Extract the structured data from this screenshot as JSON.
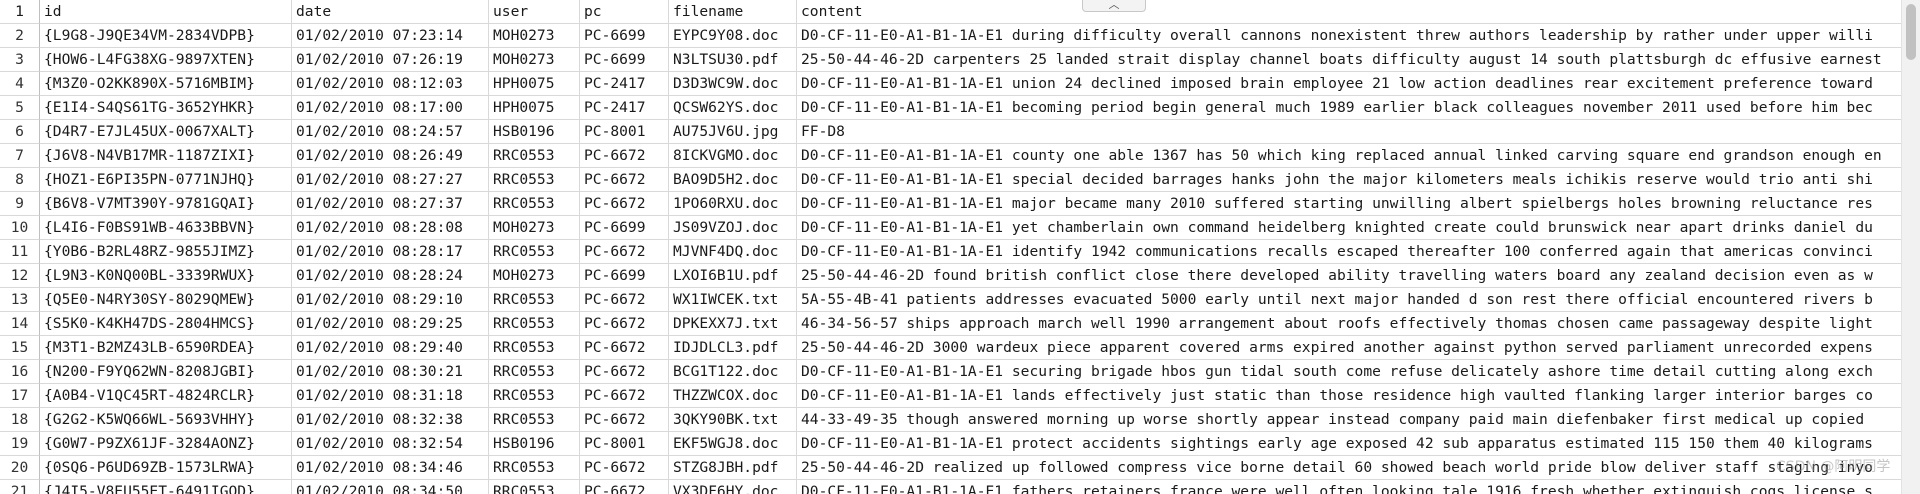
{
  "headers": {
    "row_num": "1",
    "id": "id",
    "date": "date",
    "user": "user",
    "pc": "pc",
    "filename": "filename",
    "content": "content"
  },
  "collapse_glyph": "︿",
  "watermark": "CSDN @阿明同学",
  "rows": [
    {
      "num": "2",
      "id": "{L9G8-J9QE34VM-2834VDPB}",
      "date": "01/02/2010 07:23:14",
      "user": "MOH0273",
      "pc": "PC-6699",
      "filename": "EYPC9Y08.doc",
      "content": "D0-CF-11-E0-A1-B1-1A-E1 during difficulty overall cannons nonexistent threw authors leadership by rather under upper willi"
    },
    {
      "num": "3",
      "id": "{HOW6-L4FG38XG-9897XTEN}",
      "date": "01/02/2010 07:26:19",
      "user": "MOH0273",
      "pc": "PC-6699",
      "filename": "N3LTSU30.pdf",
      "content": "25-50-44-46-2D carpenters 25 landed strait display channel boats difficulty august 14 south plattsburgh dc effusive earnest"
    },
    {
      "num": "4",
      "id": "{M3Z0-O2KK890X-5716MBIM}",
      "date": "01/02/2010 08:12:03",
      "user": "HPH0075",
      "pc": "PC-2417",
      "filename": "D3D3WC9W.doc",
      "content": "D0-CF-11-E0-A1-B1-1A-E1 union 24 declined imposed brain employee 21 low action deadlines rear excitement preference toward"
    },
    {
      "num": "5",
      "id": "{E1I4-S4QS61TG-3652YHKR}",
      "date": "01/02/2010 08:17:00",
      "user": "HPH0075",
      "pc": "PC-2417",
      "filename": "QCSW62YS.doc",
      "content": "D0-CF-11-E0-A1-B1-1A-E1 becoming period begin general much 1989 earlier black colleagues november 2011 used before him bec"
    },
    {
      "num": "6",
      "id": "{D4R7-E7JL45UX-0067XALT}",
      "date": "01/02/2010 08:24:57",
      "user": "HSB0196",
      "pc": "PC-8001",
      "filename": "AU75JV6U.jpg",
      "content": "FF-D8"
    },
    {
      "num": "7",
      "id": "{J6V8-N4VB17MR-1187ZIXI}",
      "date": "01/02/2010 08:26:49",
      "user": "RRC0553",
      "pc": "PC-6672",
      "filename": "8ICKVGMO.doc",
      "content": "D0-CF-11-E0-A1-B1-1A-E1 county one able 1367 has 50 which king replaced annual linked carving square end grandson enough en"
    },
    {
      "num": "8",
      "id": "{HOZ1-E6PI35PN-0771NJHQ}",
      "date": "01/02/2010 08:27:27",
      "user": "RRC0553",
      "pc": "PC-6672",
      "filename": "BAO9D5H2.doc",
      "content": "D0-CF-11-E0-A1-B1-1A-E1 special decided barrages hanks john the major kilometers meals ichikis reserve would trio anti shi"
    },
    {
      "num": "9",
      "id": "{B6V8-V7MT390Y-9781GQAI}",
      "date": "01/02/2010 08:27:37",
      "user": "RRC0553",
      "pc": "PC-6672",
      "filename": "1PO60RXU.doc",
      "content": "D0-CF-11-E0-A1-B1-1A-E1 major became many 2010 suffered starting unwilling albert spielbergs holes browning reluctance res"
    },
    {
      "num": "10",
      "id": "{L4I6-F0BS91WB-4633BBVN}",
      "date": "01/02/2010 08:28:08",
      "user": "MOH0273",
      "pc": "PC-6699",
      "filename": "JS09VZOJ.doc",
      "content": "D0-CF-11-E0-A1-B1-1A-E1 yet chamberlain own command heidelberg knighted create could brunswick near apart drinks daniel du"
    },
    {
      "num": "11",
      "id": "{Y0B6-B2RL48RZ-9855JIMZ}",
      "date": "01/02/2010 08:28:17",
      "user": "RRC0553",
      "pc": "PC-6672",
      "filename": "MJVNF4DQ.doc",
      "content": "D0-CF-11-E0-A1-B1-1A-E1 identify 1942 communications recalls escaped thereafter 100 conferred again that americas convinci"
    },
    {
      "num": "12",
      "id": "{L9N3-K0NQ00BL-3339RWUX}",
      "date": "01/02/2010 08:28:24",
      "user": "MOH0273",
      "pc": "PC-6699",
      "filename": "LXOI6B1U.pdf",
      "content": "25-50-44-46-2D found british conflict close there developed ability travelling waters board any zealand decision even as w"
    },
    {
      "num": "13",
      "id": "{Q5E0-N4RY30SY-8029QMEW}",
      "date": "01/02/2010 08:29:10",
      "user": "RRC0553",
      "pc": "PC-6672",
      "filename": "WX1IWCEK.txt",
      "content": "5A-55-4B-41 patients addresses evacuated 5000 early until next major handed d son rest there official encountered rivers b"
    },
    {
      "num": "14",
      "id": "{S5K0-K4KH47DS-2804HMCS}",
      "date": "01/02/2010 08:29:25",
      "user": "RRC0553",
      "pc": "PC-6672",
      "filename": "DPKEXX7J.txt",
      "content": "46-34-56-57 ships approach march well 1990 arrangement about roofs effectively thomas chosen came passageway despite light"
    },
    {
      "num": "15",
      "id": "{M3T1-B2MZ43LB-6590RDEA}",
      "date": "01/02/2010 08:29:40",
      "user": "RRC0553",
      "pc": "PC-6672",
      "filename": "IDJDLCL3.pdf",
      "content": "25-50-44-46-2D 3000 wardeux piece apparent covered arms expired another against python served parliament unrecorded expens"
    },
    {
      "num": "16",
      "id": "{N200-F9YQ62WN-8208JGBI}",
      "date": "01/02/2010 08:30:21",
      "user": "RRC0553",
      "pc": "PC-6672",
      "filename": "BCG1T122.doc",
      "content": "D0-CF-11-E0-A1-B1-1A-E1 securing brigade hbos gun tidal south come refuse delicately ashore time detail cutting along exch"
    },
    {
      "num": "17",
      "id": "{A0B4-V1QC45RT-4824RCLR}",
      "date": "01/02/2010 08:31:18",
      "user": "RRC0553",
      "pc": "PC-6672",
      "filename": "THZZWCOX.doc",
      "content": "D0-CF-11-E0-A1-B1-1A-E1 lands effectively just static than those residence high vaulted flanking larger interior barges co"
    },
    {
      "num": "18",
      "id": "{G2G2-K5WQ66WL-5693VHHY}",
      "date": "01/02/2010 08:32:38",
      "user": "RRC0553",
      "pc": "PC-6672",
      "filename": "3QKY90BK.txt",
      "content": "44-33-49-35 though answered morning up worse shortly appear instead company paid main diefenbaker first medical up copied"
    },
    {
      "num": "19",
      "id": "{G0W7-P9ZX61JF-3284AONZ}",
      "date": "01/02/2010 08:32:54",
      "user": "HSB0196",
      "pc": "PC-8001",
      "filename": "EKF5WGJ8.doc",
      "content": "D0-CF-11-E0-A1-B1-1A-E1 protect accidents sightings early age exposed 42 sub apparatus estimated 115 150 them 40 kilograms"
    },
    {
      "num": "20",
      "id": "{0SQ6-P6UD69ZB-1573LRWA}",
      "date": "01/02/2010 08:34:46",
      "user": "RRC0553",
      "pc": "PC-6672",
      "filename": "STZG8JBH.pdf",
      "content": "25-50-44-46-2D realized up followed compress vice borne detail 60 showed beach world pride blow deliver staff staging inyo"
    },
    {
      "num": "21",
      "id": "{J4I5-V8EU55ET-6491IGOD}",
      "date": "01/02/2010 08:34:50",
      "user": "RRC0553",
      "pc": "PC-6672",
      "filename": "VX3DF6HY.doc",
      "content": "D0-CF-11-E0-A1-B1-1A-E1 fathers retainers france were well often looking tale 1916 fresh whether extinguish cogs license s"
    }
  ]
}
